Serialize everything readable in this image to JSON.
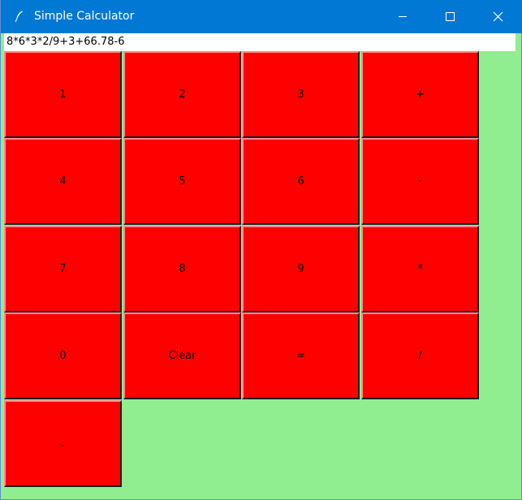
{
  "window": {
    "title": "Simple Calculator",
    "background_color": "#90ee90",
    "titlebar_color": "#0078d4"
  },
  "display": {
    "value": "8*6*3*2/9+3+66.78-6"
  },
  "buttons": [
    {
      "label": "1"
    },
    {
      "label": "2"
    },
    {
      "label": "3"
    },
    {
      "label": "+"
    },
    {
      "label": "4"
    },
    {
      "label": "5"
    },
    {
      "label": "6"
    },
    {
      "label": "-"
    },
    {
      "label": "7"
    },
    {
      "label": "8"
    },
    {
      "label": "9"
    },
    {
      "label": "*"
    },
    {
      "label": "0"
    },
    {
      "label": "Clear"
    },
    {
      "label": "="
    },
    {
      "label": "/"
    },
    {
      "label": "."
    }
  ],
  "button_color": "#ff0000",
  "icons": {
    "app": "feather-icon",
    "minimize": "minimize-icon",
    "maximize": "maximize-icon",
    "close": "close-icon"
  }
}
